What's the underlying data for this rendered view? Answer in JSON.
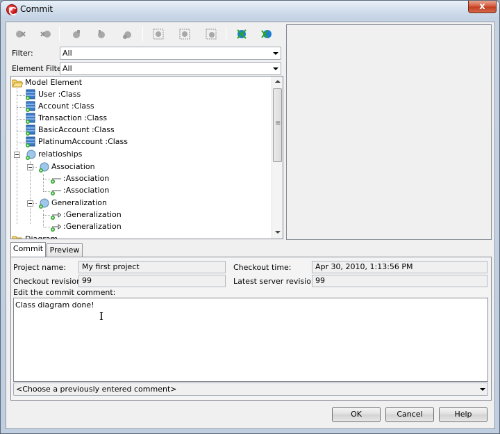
{
  "window": {
    "title": "Commit",
    "close_label": "x"
  },
  "toolbar": {
    "buttons": [
      {
        "icon": "commit-disabled-icon",
        "enabled": false
      },
      {
        "icon": "revert-disabled-icon",
        "enabled": false
      },
      {
        "icon": "lock-disabled-icon",
        "enabled": false
      },
      {
        "icon": "unlock-disabled-icon",
        "enabled": false
      },
      {
        "icon": "refresh-disabled-icon",
        "enabled": false
      },
      {
        "icon": "select-all-disabled-icon",
        "enabled": false
      },
      {
        "icon": "select-none-disabled-icon",
        "enabled": false
      },
      {
        "icon": "select-invert-disabled-icon",
        "enabled": false
      },
      {
        "icon": "expand-all-icon",
        "enabled": true
      },
      {
        "icon": "collapse-all-icon",
        "enabled": true
      }
    ]
  },
  "filter": {
    "label": "Filter:",
    "value": "All"
  },
  "element_filter": {
    "label": "Element Filter:",
    "value": "All"
  },
  "tree": {
    "root": "Model Element",
    "classes": [
      "User :Class",
      "Account :Class",
      "Transaction :Class",
      "BasicAccount :Class",
      "PlatinumAccount :Class"
    ],
    "relationships": "relatioships",
    "association": "Association",
    "associations": [
      ":Association",
      ":Association"
    ],
    "generalization": "Generalization",
    "generalizations": [
      ":Generalization",
      ":Generalization"
    ],
    "diagram": "Diagram"
  },
  "tabs": {
    "commit": "Commit",
    "preview": "Preview"
  },
  "info": {
    "project_name_label": "Project name:",
    "project_name": "My first project",
    "checkout_revision_label": "Checkout revision:",
    "checkout_revision": "99",
    "checkout_time_label": "Checkout time:",
    "checkout_time": "Apr 30, 2010, 1:13:56 PM",
    "latest_revision_label": "Latest server revision:",
    "latest_revision": "99"
  },
  "comment": {
    "label": "Edit the commit comment:",
    "value": "Class diagram done!",
    "history_placeholder": "<Choose a previously entered comment>"
  },
  "buttons": {
    "ok": "OK",
    "cancel": "Cancel",
    "help": "Help"
  },
  "colors": {
    "class_icon": "#3a7bc8",
    "added_badge": "#2aa52a",
    "disabled_icon": "#a0a0a0",
    "enabled_icon": "#1e7fd0"
  }
}
